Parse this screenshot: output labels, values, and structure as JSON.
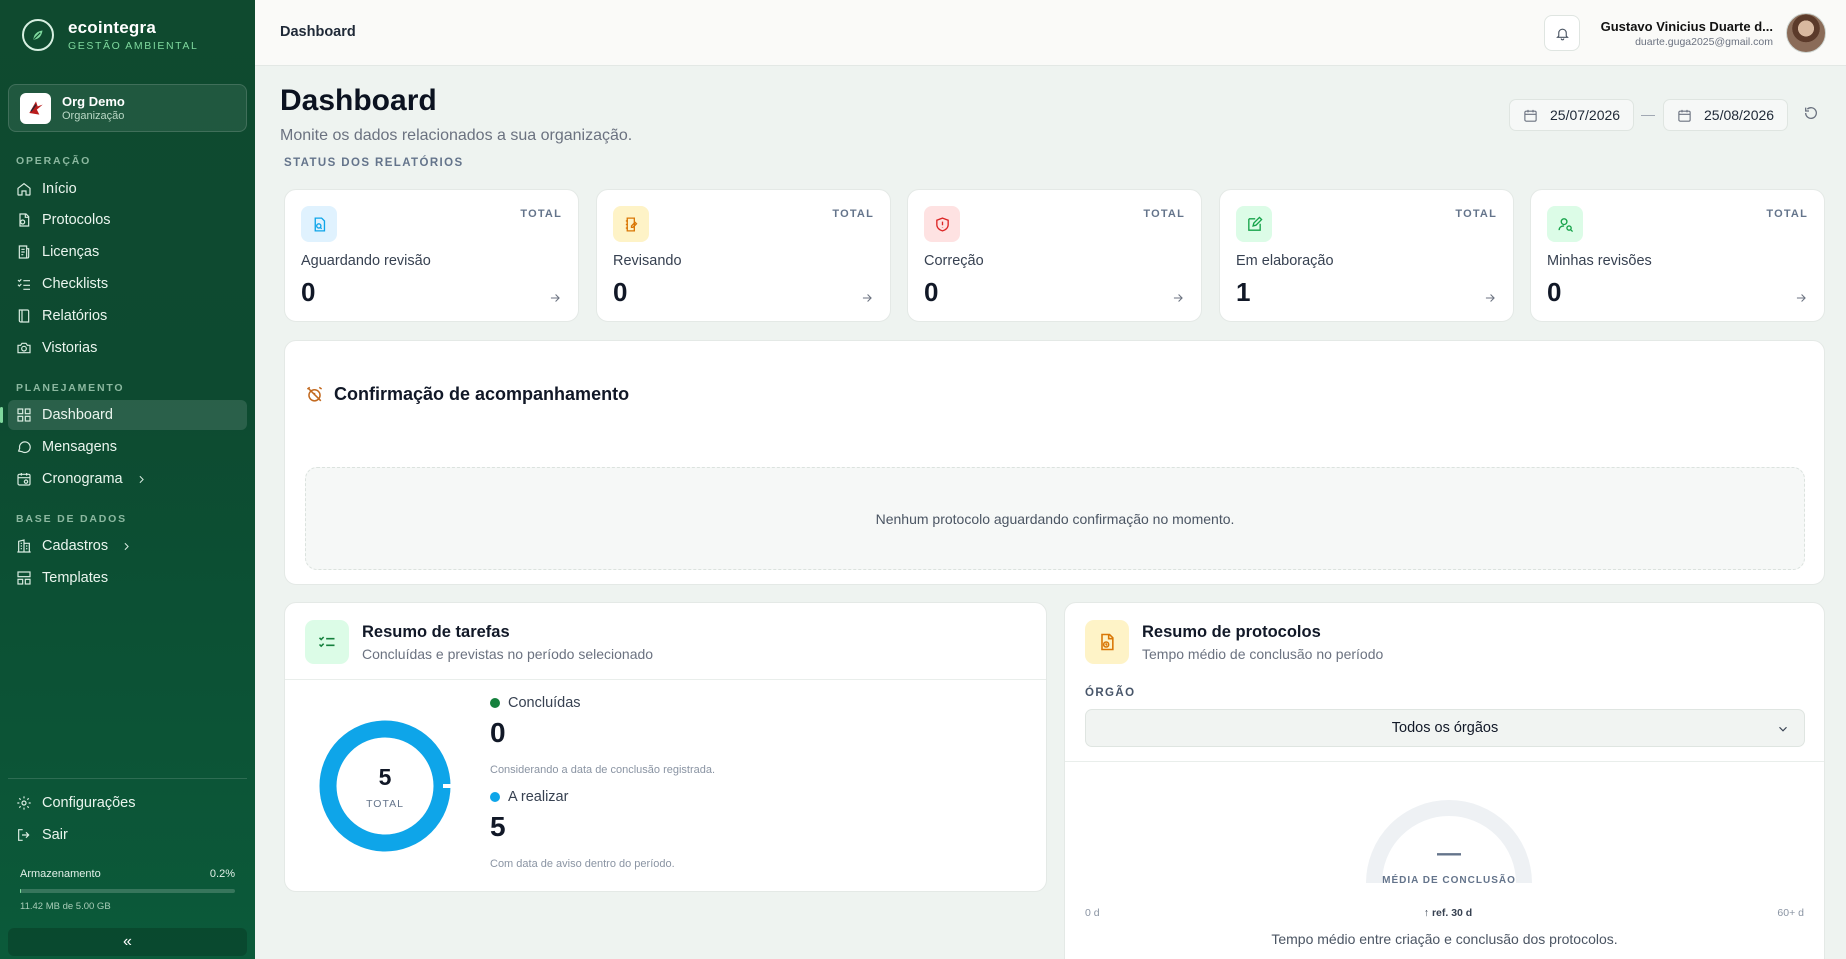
{
  "brand": {
    "name": "ecointegra",
    "tagline": "GESTÃO AMBIENTAL"
  },
  "org": {
    "name": "Org Demo",
    "type": "Organização"
  },
  "sidebar": {
    "sections": [
      {
        "title": "OPERAÇÃO"
      },
      {
        "title": "PLANEJAMENTO"
      },
      {
        "title": "BASE DE DADOS"
      }
    ],
    "items": [
      {
        "label": "Início",
        "icon": "home-icon"
      },
      {
        "label": "Protocolos",
        "icon": "file-icon"
      },
      {
        "label": "Licenças",
        "icon": "license-icon"
      },
      {
        "label": "Checklists",
        "icon": "checklist-icon"
      },
      {
        "label": "Relatórios",
        "icon": "book-icon"
      },
      {
        "label": "Vistorias",
        "icon": "camera-icon"
      },
      {
        "label": "Dashboard",
        "icon": "dashboard-icon",
        "active": true
      },
      {
        "label": "Mensagens",
        "icon": "message-icon"
      },
      {
        "label": "Cronograma",
        "icon": "calendar-icon"
      },
      {
        "label": "Cadastros",
        "icon": "building-icon"
      },
      {
        "label": "Templates",
        "icon": "template-icon"
      }
    ],
    "footer": [
      {
        "label": "Configurações",
        "icon": "gear-icon"
      },
      {
        "label": "Sair",
        "icon": "logout-icon"
      }
    ],
    "storage": {
      "label": "Armazenamento",
      "percent_text": "0.2%",
      "percent": 0.2,
      "used": "11.42 MB de 5.00 GB"
    },
    "collapse": "«"
  },
  "header": {
    "breadcrumb": "Dashboard",
    "user_name": "Gustavo Vinicius Duarte d...",
    "user_email": "duarte.guga2025@gmail.com"
  },
  "page": {
    "title": "Dashboard",
    "subtitle": "Monite os dados relacionados a sua organização.",
    "date_start": "25/07/2026",
    "date_sep": "—",
    "date_end": "25/08/2026",
    "status_section": "STATUS DOS RELATÓRIOS"
  },
  "stats": [
    {
      "label": "Aguardando revisão",
      "value": "0",
      "total": "TOTAL",
      "color": "#0ea5e9",
      "bg": "#e0f2fe"
    },
    {
      "label": "Revisando",
      "value": "0",
      "total": "TOTAL",
      "color": "#d97706",
      "bg": "#fef3c7"
    },
    {
      "label": "Correção",
      "value": "0",
      "total": "TOTAL",
      "color": "#dc2626",
      "bg": "#fee2e2"
    },
    {
      "label": "Em elaboração",
      "value": "1",
      "total": "TOTAL",
      "color": "#16a34a",
      "bg": "#dcfce7"
    },
    {
      "label": "Minhas revisões",
      "value": "0",
      "total": "TOTAL",
      "color": "#16a34a",
      "bg": "#dcfce7"
    }
  ],
  "confirmation": {
    "title": "Confirmação de acompanhamento",
    "empty": "Nenhum protocolo aguardando confirmação no momento."
  },
  "tasks": {
    "title": "Resumo de tarefas",
    "subtitle": "Concluídas e previstas no período selecionado",
    "total": "5",
    "total_label": "TOTAL",
    "done_label": "Concluídas",
    "done_value": "0",
    "done_note": "Considerando a data de conclusão registrada.",
    "todo_label": "A realizar",
    "todo_value": "5",
    "todo_note": "Com data de aviso dentro do período.",
    "done_color": "#15803d",
    "todo_color": "#0ea5e9"
  },
  "protocols": {
    "title": "Resumo de protocolos",
    "subtitle": "Tempo médio de conclusão no período",
    "field_label": "ÓRGÃO",
    "select_value": "Todos os órgãos",
    "gauge_value": "—",
    "gauge_caption": "MÉDIA DE CONCLUSÃO",
    "scale_min": "0 d",
    "scale_ref": "↑ ref. 30 d",
    "scale_max": "60+ d",
    "note": "Tempo médio entre criação e conclusão dos protocolos."
  }
}
